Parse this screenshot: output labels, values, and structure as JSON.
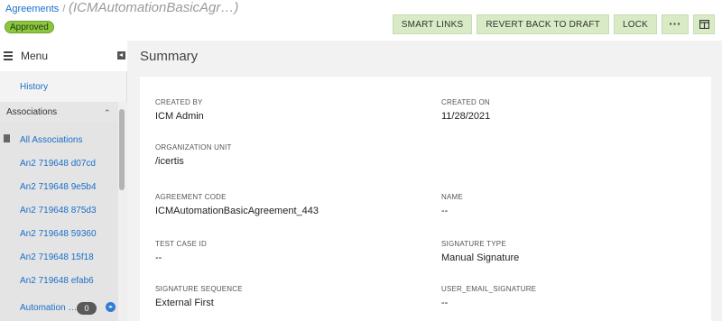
{
  "breadcrumb": {
    "root": "Agreements",
    "separator": "/",
    "title": "(ICMAutomationBasicAgr…)"
  },
  "status": {
    "label": "Approved",
    "color": "#8cc63f"
  },
  "actions": {
    "smart_links": "SMART LINKS",
    "revert": "REVERT BACK TO DRAFT",
    "lock": "LOCK",
    "more": "···",
    "layout_icon": "panel-layout-icon"
  },
  "sidebar": {
    "menu_label": "Menu",
    "history": "History",
    "associations_label": "Associations",
    "associations": [
      "All Associations",
      "An2 719648 d07cd",
      "An2 719648 9e5b4",
      "An2 719648 875d3",
      "An2 719648 59360",
      "An2 719648 15f18",
      "An2 719648 efab6",
      "Automation …"
    ],
    "automation_count": "0"
  },
  "main": {
    "title": "Summary",
    "fields": [
      {
        "label": "CREATED BY",
        "value": "ICM Admin"
      },
      {
        "label": "CREATED ON",
        "value": "11/28/2021"
      },
      {
        "label": "ORGANIZATION UNIT",
        "value": "/icertis"
      },
      {
        "label": "AGREEMENT CODE",
        "value": "ICMAutomationBasicAgreement_443"
      },
      {
        "label": "NAME",
        "value": "--"
      },
      {
        "label": "TEST CASE ID",
        "value": "--"
      },
      {
        "label": "SIGNATURE TYPE",
        "value": "Manual Signature"
      },
      {
        "label": "SIGNATURE SEQUENCE",
        "value": "External First"
      },
      {
        "label": "USER_EMAIL_SIGNATURE",
        "value": "--"
      }
    ]
  },
  "colors": {
    "link": "#1a6fc9",
    "action_bg": "#d8ebc6",
    "status": "#8cc63f"
  }
}
